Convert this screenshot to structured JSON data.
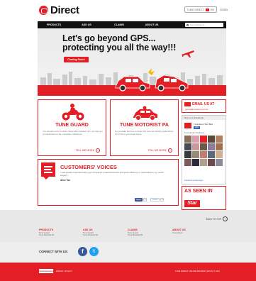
{
  "header": {
    "logo_text": "Direct",
    "lang_label": "TUNE DIRECT",
    "lang_code": "EN",
    "login_label": "LOGIN"
  },
  "nav": {
    "items": [
      "PRODUCTS",
      "ASK US",
      "CLAIMS",
      "ABOUT US"
    ],
    "search_placeholder": "I am looking for..."
  },
  "hero": {
    "headline_line1": "Let's go beyond GPS...",
    "headline_line2": "protecting you all the way!!!",
    "cta": "Coming Soon!"
  },
  "products": [
    {
      "title": "TUNE GUARD",
      "desc": "You should not be a victim. Even with crashed cars, we help get yourself back on the road after misfortune.",
      "more": "TELL ME MORE"
    },
    {
      "title": "TUNE MOTORIST PA",
      "desc": "Do you take the time to keep that new car looking sleek all the time? Don't you forget those.",
      "more": "TELL ME MORE"
    }
  ],
  "sidebar": {
    "email_title": "EMAIL US AT",
    "email_addr": "general@tunedirect.com.my",
    "fb_header": "Find us on Facebook",
    "fb_page": "TuneDirect Sdn Bhd",
    "fb_like": "Like",
    "fb_count": "9 people like TuneDirect",
    "fb_plugin": "Facebook social plugin",
    "seen_in": "AS SEEN IN",
    "seen_logo": "Star"
  },
  "voices": {
    "title": "CUSTOMERS' VOICES",
    "quote": "I was greatly impressed with your company's professional time and great efficiency in responding to my recent enquiry...",
    "author": "Alice Tan",
    "share_fb": "Share",
    "share_fb_count": "0",
    "share_tw": "Tweet",
    "share_tw_count": "0"
  },
  "footer": {
    "back_to_top": "BACK TO TOP",
    "cols": [
      {
        "h": "PRODUCTS",
        "links": [
          "Tune Guard",
          "Tune Motorist PA"
        ]
      },
      {
        "h": "ASK US",
        "links": [
          "Tune Guard",
          "Tune Motorist PA"
        ]
      },
      {
        "h": "CLAIMS",
        "links": [
          "Tune Guard",
          "Tune Motorist PA"
        ]
      },
      {
        "h": "ABOUT US",
        "links": [
          "Tune Direct"
        ]
      }
    ],
    "connect": "CONNECT WITH US:",
    "insurer": "tuneinsurance",
    "privacy": "PRIVACY POLICY",
    "copyright": "TUNE DIRECT ONLINE SDN BHD (ADVT) © 2014"
  },
  "colors": {
    "brand": "#e31e24",
    "nav": "#111111"
  }
}
